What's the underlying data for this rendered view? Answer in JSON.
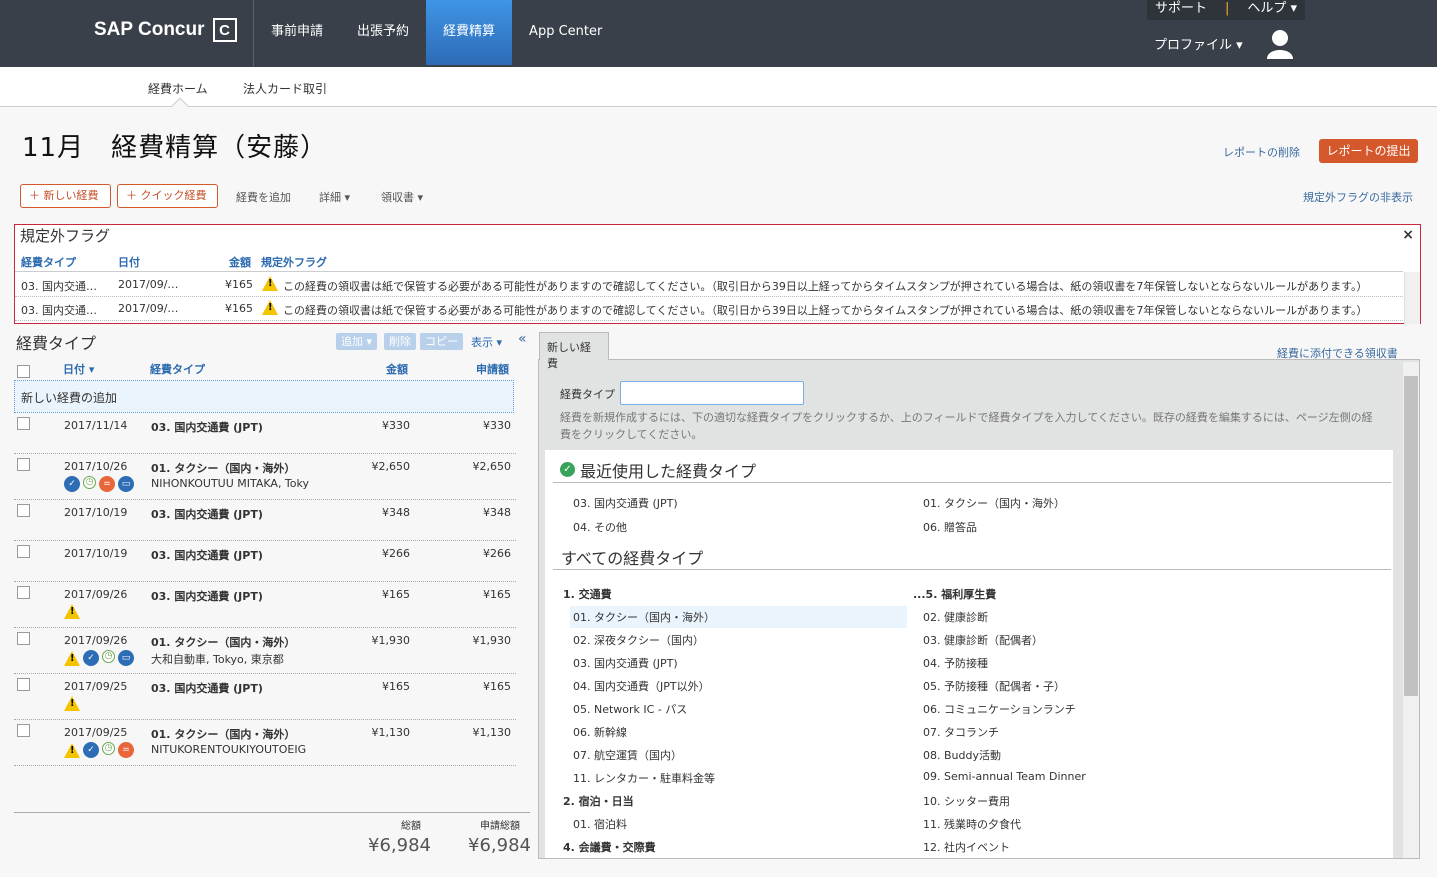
{
  "header": {
    "logo": "SAP Concur",
    "nav": [
      "事前申請",
      "出張予約",
      "経費精算",
      "App Center"
    ],
    "active_nav": "経費精算",
    "support": "サポート",
    "sep": "|",
    "help": "ヘルプ ▾",
    "profile": "プロファイル ▾"
  },
  "subnav": [
    "経費ホーム",
    "法人カード取引"
  ],
  "title": "11月　経費精算（安藤）",
  "actions": {
    "delete": "レポートの削除",
    "submit": "レポートの提出",
    "hide_flags": "規定外フラグの非表示",
    "new_expense": "＋ 新しい経費",
    "quick_expense": "＋ クイック経費",
    "add_expense": "経費を追加",
    "details": "詳細 ▾",
    "receipts": "領収書 ▾"
  },
  "flags": {
    "title": "規定外フラグ",
    "close": "×",
    "headers": [
      "経費タイプ",
      "日付",
      "金額",
      "規定外フラグ"
    ],
    "rows": [
      {
        "type": "03. 国内交通…",
        "date": "2017/09/…",
        "amount": "¥165",
        "msg": "この経費の領収書は紙で保管する必要がある可能性がありますので確認してください。（取引日から39日以上経ってからタイムスタンプが押されている場合は、紙の領収書を7年保管しないとならないルールがあります。）"
      },
      {
        "type": "03. 国内交通…",
        "date": "2017/09/…",
        "amount": "¥165",
        "msg": "この経費の領収書は紙で保管する必要がある可能性がありますので確認してください。（取引日から39日以上経ってからタイムスタンプが押されている場合は、紙の領収書を7年保管しないとならないルールがあります。）"
      }
    ]
  },
  "left": {
    "title": "経費タイプ",
    "toolbar": [
      "追加 ▾",
      "削除",
      "コピー"
    ],
    "view": "表示 ▾",
    "collapse": "«",
    "headers": [
      "日付 ▾",
      "経費タイプ",
      "金額",
      "申請額"
    ],
    "add_row": "新しい経費の追加",
    "rows": [
      {
        "date": "2017/11/14",
        "type": "03. 国内交通費 (JPT)",
        "sub": "",
        "amount": "¥330",
        "claimed": "¥330",
        "icons": []
      },
      {
        "date": "2017/10/26",
        "type": "01. タクシー（国内・海外）",
        "sub": "NIHONKOUTUU MITAKA, Toky",
        "amount": "¥2,650",
        "claimed": "¥2,650",
        "icons": [
          "receipt",
          "clock",
          "no-entry",
          "comment"
        ]
      },
      {
        "date": "2017/10/19",
        "type": "03. 国内交通費 (JPT)",
        "sub": "",
        "amount": "¥348",
        "claimed": "¥348",
        "icons": []
      },
      {
        "date": "2017/10/19",
        "type": "03. 国内交通費 (JPT)",
        "sub": "",
        "amount": "¥266",
        "claimed": "¥266",
        "icons": []
      },
      {
        "date": "2017/09/26",
        "type": "03. 国内交通費 (JPT)",
        "sub": "",
        "amount": "¥165",
        "claimed": "¥165",
        "icons": [
          "warning"
        ]
      },
      {
        "date": "2017/09/26",
        "type": "01. タクシー（国内・海外）",
        "sub": "大和自動車, Tokyo, 東京都",
        "amount": "¥1,930",
        "claimed": "¥1,930",
        "icons": [
          "warning",
          "receipt",
          "clock",
          "comment"
        ]
      },
      {
        "date": "2017/09/25",
        "type": "03. 国内交通費 (JPT)",
        "sub": "",
        "amount": "¥165",
        "claimed": "¥165",
        "icons": [
          "warning"
        ]
      },
      {
        "date": "2017/09/25",
        "type": "01. タクシー（国内・海外）",
        "sub": "NITUKORENTOUKIYOUTOEIG",
        "amount": "¥1,130",
        "claimed": "¥1,130",
        "icons": [
          "warning",
          "receipt",
          "clock",
          "no-entry"
        ]
      }
    ],
    "total_label": "総額",
    "claimed_total_label": "申請総額",
    "total": "¥6,984",
    "claimed_total": "¥6,984"
  },
  "right": {
    "tab": "新しい経費",
    "receipts_link": "経費に添付できる領収書",
    "field_label": "経費タイプ",
    "field_value": "",
    "help": "経費を新規作成するには、下の適切な経費タイプをクリックするか、上のフィールドで経費タイプを入力してください。既存の経費を編集するには、ページ左側の経費をクリックしてください。",
    "recent_title": "最近使用した経費タイプ",
    "recent": [
      "03. 国内交通費 (JPT)",
      "01. タクシー（国内・海外）",
      "04. その他",
      "06. 贈答品"
    ],
    "all_title": "すべての経費タイプ",
    "col1": [
      {
        "g": "1. 交通費"
      },
      {
        "i": "01. タクシー（国内・海外）",
        "hl": true
      },
      {
        "i": "02. 深夜タクシー（国内）"
      },
      {
        "i": "03. 国内交通費 (JPT)"
      },
      {
        "i": "04. 国内交通費（JPT以外）"
      },
      {
        "i": "05. Network IC - パス"
      },
      {
        "i": "06. 新幹線"
      },
      {
        "i": "07. 航空運賃（国内）"
      },
      {
        "i": "11. レンタカー・駐車料金等"
      },
      {
        "g": "2. 宿泊・日当"
      },
      {
        "i": "01. 宿泊料"
      },
      {
        "g": "4. 会議費・交際費"
      }
    ],
    "col2": [
      {
        "g": "...5. 福利厚生費"
      },
      {
        "i": "02. 健康診断"
      },
      {
        "i": "03. 健康診断（配偶者）"
      },
      {
        "i": "04. 予防接種"
      },
      {
        "i": "05. 予防接種（配偶者・子）"
      },
      {
        "i": "06. コミュニケーションランチ"
      },
      {
        "i": "07. タコランチ"
      },
      {
        "i": "08. Buddy活動"
      },
      {
        "i": "09. Semi-annual Team Dinner"
      },
      {
        "i": "10. シッター費用"
      },
      {
        "i": "11. 残業時の夕食代"
      },
      {
        "i": "12. 社内イベント"
      }
    ]
  },
  "colors": {
    "header": "#3a4049",
    "active_nav": "#2d7dd2",
    "accent": "#d4582b",
    "link": "#2c6bb0",
    "flag_border": "#c8283c"
  }
}
